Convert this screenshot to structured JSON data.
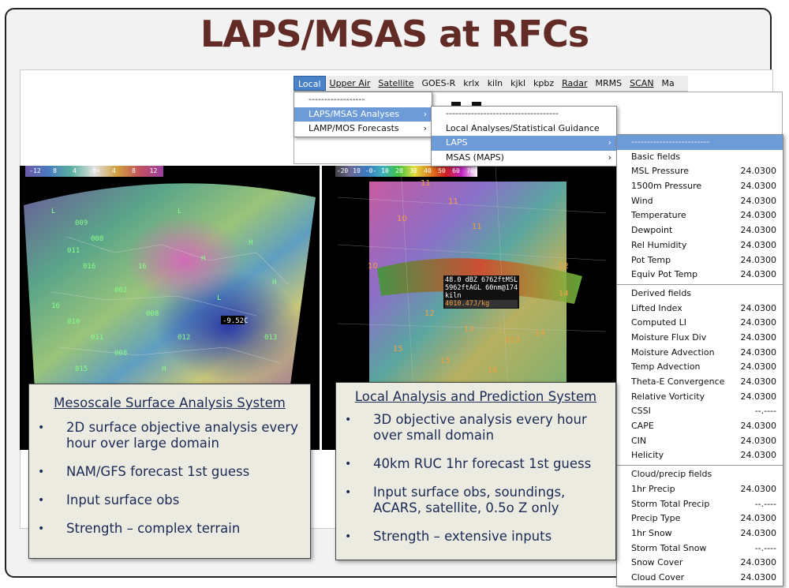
{
  "slide": {
    "title": "LAPS/MSAS at RFCs"
  },
  "menubar": {
    "items": [
      {
        "label": "Local",
        "active": true
      },
      {
        "label": "Upper Air"
      },
      {
        "label": "Satellite"
      },
      {
        "label": "GOES-R"
      },
      {
        "label": "krlx"
      },
      {
        "label": "kiln"
      },
      {
        "label": "kjkl"
      },
      {
        "label": "kpbz"
      },
      {
        "label": "Radar"
      },
      {
        "label": "MRMS"
      },
      {
        "label": "SCAN"
      },
      {
        "label": "Ma"
      }
    ]
  },
  "menu_local": {
    "items": [
      {
        "label": "------------------"
      },
      {
        "label": "LAPS/MSAS Analyses",
        "highlight": true,
        "submenu": true
      },
      {
        "label": "LAMP/MOS Forecasts",
        "submenu": true
      }
    ]
  },
  "menu_analyses": {
    "items": [
      {
        "label": "------------------------------------"
      },
      {
        "label": "Local Analyses/Statistical Guidance"
      },
      {
        "label": "LAPS",
        "highlight": true,
        "submenu": true
      },
      {
        "label": "MSAS (MAPS)",
        "submenu": true
      }
    ]
  },
  "menu_laps": {
    "sections": [
      {
        "rows": [
          {
            "label": "-------------------------",
            "highlight": true
          },
          {
            "label": "Basic fields"
          },
          {
            "label": "MSL Pressure",
            "value": "24.0300"
          },
          {
            "label": "1500m Pressure",
            "value": "24.0300"
          },
          {
            "label": "Wind",
            "value": "24.0300"
          },
          {
            "label": "Temperature",
            "value": "24.0300"
          },
          {
            "label": "Dewpoint",
            "value": "24.0300"
          },
          {
            "label": "Rel Humidity",
            "value": "24.0300"
          },
          {
            "label": "Pot Temp",
            "value": "24.0300"
          },
          {
            "label": "Equiv Pot Temp",
            "value": "24.0300"
          }
        ]
      },
      {
        "rows": [
          {
            "label": "Derived fields"
          },
          {
            "label": "Lifted Index",
            "value": "24.0300"
          },
          {
            "label": "Computed LI",
            "value": "24.0300"
          },
          {
            "label": "Moisture Flux Div",
            "value": "24.0300"
          },
          {
            "label": "Moisture Advection",
            "value": "24.0300"
          },
          {
            "label": "Temp Advection",
            "value": "24.0300"
          },
          {
            "label": "Theta-E Convergence",
            "value": "24.0300"
          },
          {
            "label": "Relative Vorticity",
            "value": "24.0300"
          },
          {
            "label": "CSSI",
            "value": "--.----"
          },
          {
            "label": "CAPE",
            "value": "24.0300"
          },
          {
            "label": "CIN",
            "value": "24.0300"
          },
          {
            "label": "Helicity",
            "value": "24.0300"
          }
        ]
      },
      {
        "rows": [
          {
            "label": "Cloud/precip fields"
          },
          {
            "label": "1hr Precip",
            "value": "24.0300"
          },
          {
            "label": "Storm Total Precip",
            "value": "--.----"
          },
          {
            "label": "Precip Type",
            "value": "24.0300"
          },
          {
            "label": "1hr Snow",
            "value": "24.0300"
          },
          {
            "label": "Storm Total Snow",
            "value": "--.----"
          },
          {
            "label": "Snow Cover",
            "value": "24.0300"
          },
          {
            "label": "Cloud Cover",
            "value": "24.0300"
          }
        ]
      }
    ]
  },
  "colorbar_left": [
    "-12",
    "8",
    "4",
    "-0+",
    "4",
    "8",
    "12"
  ],
  "colorbar_right": [
    "-20",
    "10",
    "-0-",
    "10",
    "20",
    "30",
    "40",
    "50",
    "60",
    "70"
  ],
  "probe": {
    "lines": [
      "48.0 dBZ 6762ftMSL",
      "5962ftAGL 60nm@174",
      "kiln",
      "4010.47J/kg"
    ]
  },
  "map_left": {
    "readout": "-9.52C"
  },
  "map_right": {
    "contour_labels": [
      "11",
      "11",
      "10",
      "10",
      "11",
      "12",
      "12",
      "13",
      "13",
      "14",
      "14",
      "15",
      "15",
      "16",
      "013"
    ]
  },
  "callout_msas": {
    "title": "Mesoscale Surface Analysis System",
    "bullets": [
      "2D surface objective analysis every hour over large domain",
      "NAM/GFS forecast 1st guess",
      "Input surface obs",
      "Strength – complex terrain"
    ]
  },
  "callout_laps": {
    "title": "Local Analysis and Prediction System",
    "bullets": [
      "3D objective analysis every hour over small domain",
      "40km RUC 1hr forecast 1st guess",
      "Input surface obs, soundings, ACARS, satellite, 0.5o Z only",
      "Strength – extensive inputs"
    ]
  },
  "colors": {
    "title": "#632b26",
    "callout_text": "#1a2a55",
    "menu_highlight": "#6c9bd8",
    "menubar_active": "#4a82c9"
  }
}
